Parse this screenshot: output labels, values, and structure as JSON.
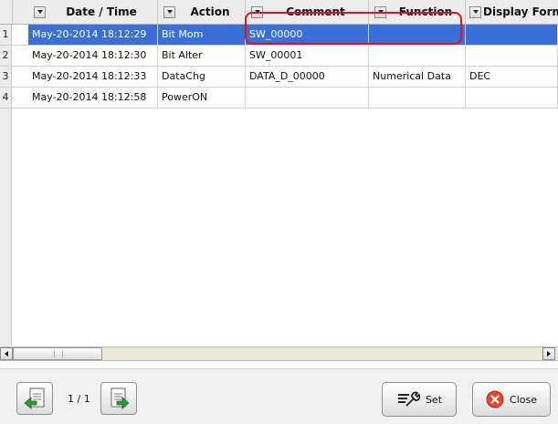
{
  "table": {
    "columns": [
      {
        "label": "Date / Time"
      },
      {
        "label": "Action"
      },
      {
        "label": "Comment"
      },
      {
        "label": "Function"
      },
      {
        "label": "Display Form"
      }
    ],
    "rows": [
      {
        "num": "1",
        "date": "May-20-2014 18:12:29",
        "action": "Bit Mom",
        "comment": "SW_00000",
        "function": "",
        "display": ""
      },
      {
        "num": "2",
        "date": "May-20-2014 18:12:30",
        "action": "Bit Alter",
        "comment": "SW_00001",
        "function": "",
        "display": ""
      },
      {
        "num": "3",
        "date": "May-20-2014 18:12:33",
        "action": "DataChg",
        "comment": "DATA_D_00000",
        "function": "Numerical Data",
        "display": "DEC"
      },
      {
        "num": "4",
        "date": "May-20-2014 18:12:58",
        "action": "PowerON",
        "comment": "",
        "function": "",
        "display": ""
      }
    ],
    "selected_row": 1,
    "selection_color": "#3a6fd8",
    "highlight_color": "#e0141e"
  },
  "footer": {
    "page_indicator": "1 / 1",
    "set_label": "Set",
    "close_label": "Close"
  }
}
